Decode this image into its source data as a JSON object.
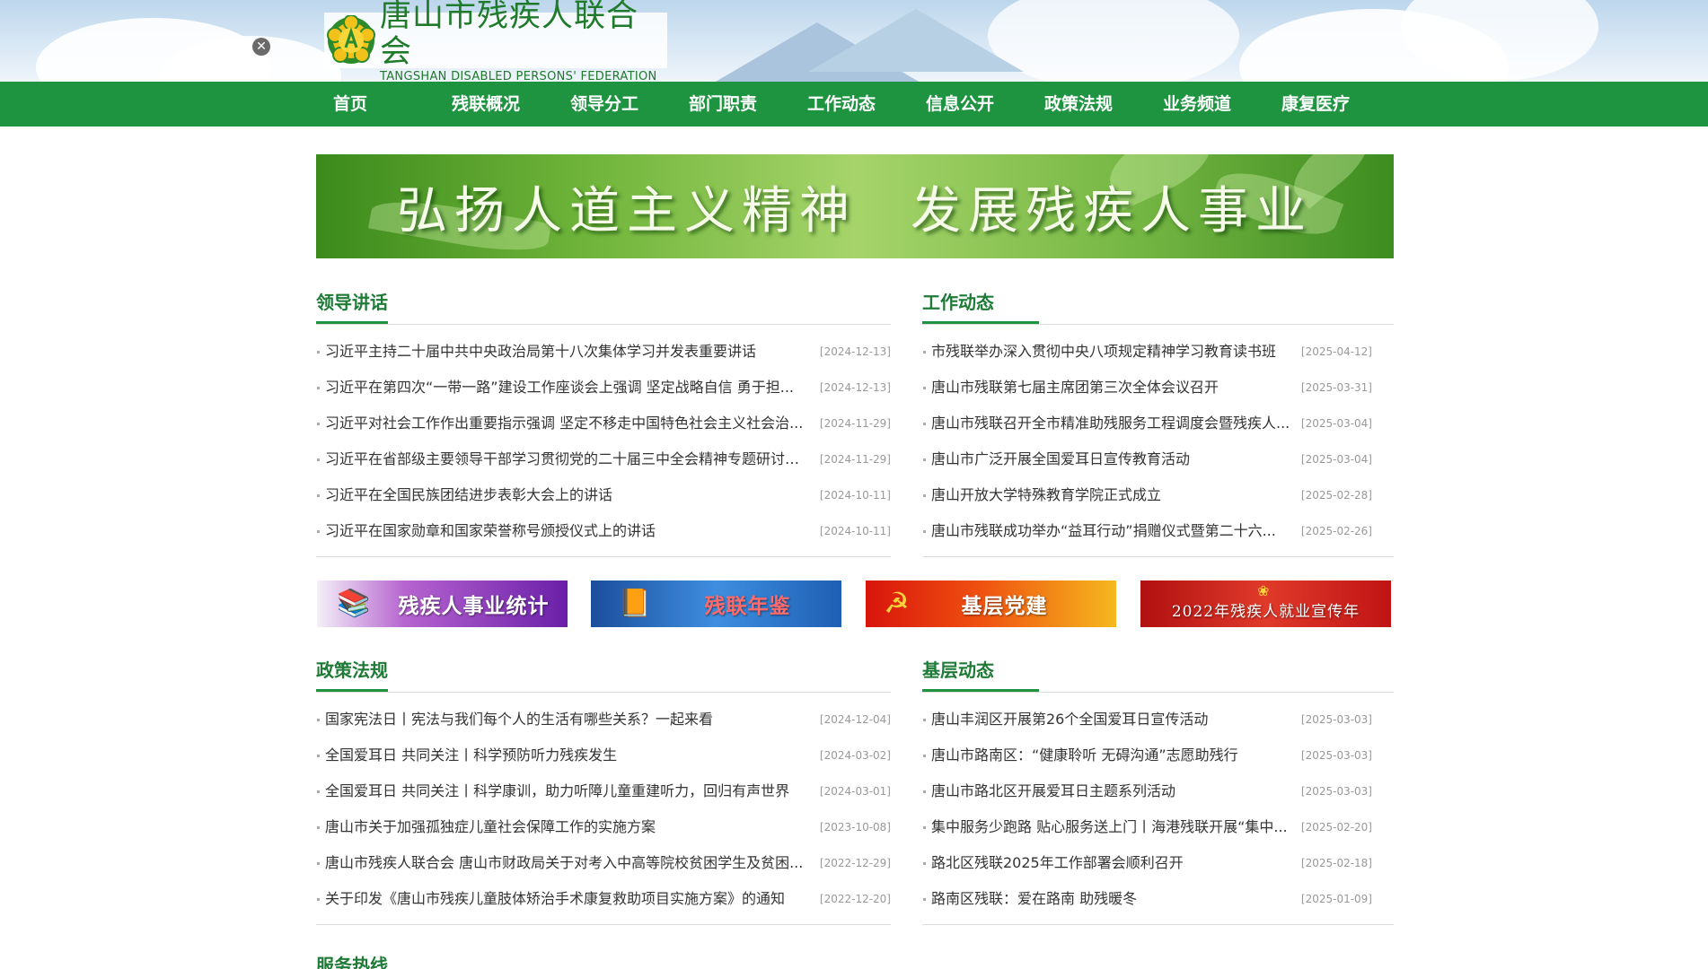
{
  "header": {
    "logo_cn": "唐山市残疾人联合会",
    "logo_en": "TANGSHAN DISABLED PERSONS' FEDERATION",
    "close_symbol": "✕"
  },
  "nav": {
    "items": [
      {
        "label": "首页"
      },
      {
        "label": "残联概况"
      },
      {
        "label": "领导分工"
      },
      {
        "label": "部门职责"
      },
      {
        "label": "工作动态"
      },
      {
        "label": "信息公开"
      },
      {
        "label": "政策法规"
      },
      {
        "label": "业务频道"
      },
      {
        "label": "康复医疗"
      }
    ]
  },
  "banner": {
    "line1": "弘扬人道主义精神",
    "line2": "发展残疾人事业"
  },
  "leader_speech": {
    "title": "领导讲话",
    "items": [
      {
        "title": "习近平主持二十届中共中央政治局第十八次集体学习并发表重要讲话",
        "date": "[2024-12-13]"
      },
      {
        "title": "习近平在第四次“一带一路”建设工作座谈会上强调 坚定战略自信 勇于担...",
        "date": "[2024-12-13]"
      },
      {
        "title": "习近平对社会工作作出重要指示强调 坚定不移走中国特色社会主义社会治...",
        "date": "[2024-11-29]"
      },
      {
        "title": "习近平在省部级主要领导干部学习贯彻党的二十届三中全会精神专题研讨班...",
        "date": "[2024-11-29]"
      },
      {
        "title": "习近平在全国民族团结进步表彰大会上的讲话",
        "date": "[2024-10-11]"
      },
      {
        "title": "习近平在国家勋章和国家荣誉称号颁授仪式上的讲话",
        "date": "[2024-10-11]"
      }
    ]
  },
  "work_news": {
    "title": "工作动态",
    "items": [
      {
        "title": "市残联举办深入贯彻中央八项规定精神学习教育读书班",
        "date": "[2025-04-12]"
      },
      {
        "title": "唐山市残联第七届主席团第三次全体会议召开",
        "date": "[2025-03-31]"
      },
      {
        "title": "唐山市残联召开全市精准助残服务工程调度会暨残疾人...",
        "date": "[2025-03-04]"
      },
      {
        "title": "唐山市广泛开展全国爱耳日宣传教育活动",
        "date": "[2025-03-04]"
      },
      {
        "title": "唐山开放大学特殊教育学院正式成立",
        "date": "[2025-02-28]"
      },
      {
        "title": "唐山市残联成功举办“益耳行动”捐赠仪式暨第二十六...",
        "date": "[2025-02-26]"
      }
    ]
  },
  "features": [
    {
      "label": "残疾人事业统计",
      "color_from": "#6a1fa8",
      "color_to": "#d37be0"
    },
    {
      "label": "残联年鉴",
      "color_from": "#1e5fb4",
      "color_to": "#3f8ee0"
    },
    {
      "label": "基层党建",
      "color_from": "#d8140c",
      "color_to": "#f5b81e"
    },
    {
      "label": "2022年残疾人就业宣传年",
      "color_from": "#c01414",
      "color_to": "#e03a2a"
    }
  ],
  "policy": {
    "title": "政策法规",
    "items": [
      {
        "title": "国家宪法日丨宪法与我们每个人的生活有哪些关系？一起来看",
        "date": "[2024-12-04]"
      },
      {
        "title": "全国爱耳日 共同关注丨科学预防听力残疾发生",
        "date": "[2024-03-02]"
      },
      {
        "title": "全国爱耳日 共同关注丨科学康训，助力听障儿童重建听力，回归有声世界",
        "date": "[2024-03-01]"
      },
      {
        "title": "唐山市关于加强孤独症儿童社会保障工作的实施方案",
        "date": "[2023-10-08]"
      },
      {
        "title": "唐山市残疾人联合会 唐山市财政局关于对考入中高等院校贫困学生及贫困...",
        "date": "[2022-12-29]"
      },
      {
        "title": "关于印发《唐山市残疾儿童肢体矫治手术康复救助项目实施方案》的通知",
        "date": "[2022-12-20]"
      }
    ]
  },
  "grassroots": {
    "title": "基层动态",
    "items": [
      {
        "title": "唐山丰润区开展第26个全国爱耳日宣传活动",
        "date": "[2025-03-03]"
      },
      {
        "title": "唐山市路南区：“健康聆听 无碍沟通”志愿助残行",
        "date": "[2025-03-03]"
      },
      {
        "title": "唐山市路北区开展爱耳日主题系列活动",
        "date": "[2025-03-03]"
      },
      {
        "title": "集中服务少跑路 贴心服务送上门丨海港残联开展“集中...",
        "date": "[2025-02-20]"
      },
      {
        "title": "路北区残联2025年工作部署会顺利召开",
        "date": "[2025-02-18]"
      },
      {
        "title": "路南区残联：爱在路南 助残暖冬",
        "date": "[2025-01-09]"
      }
    ]
  },
  "bottom_section": {
    "title": "服务热线"
  }
}
